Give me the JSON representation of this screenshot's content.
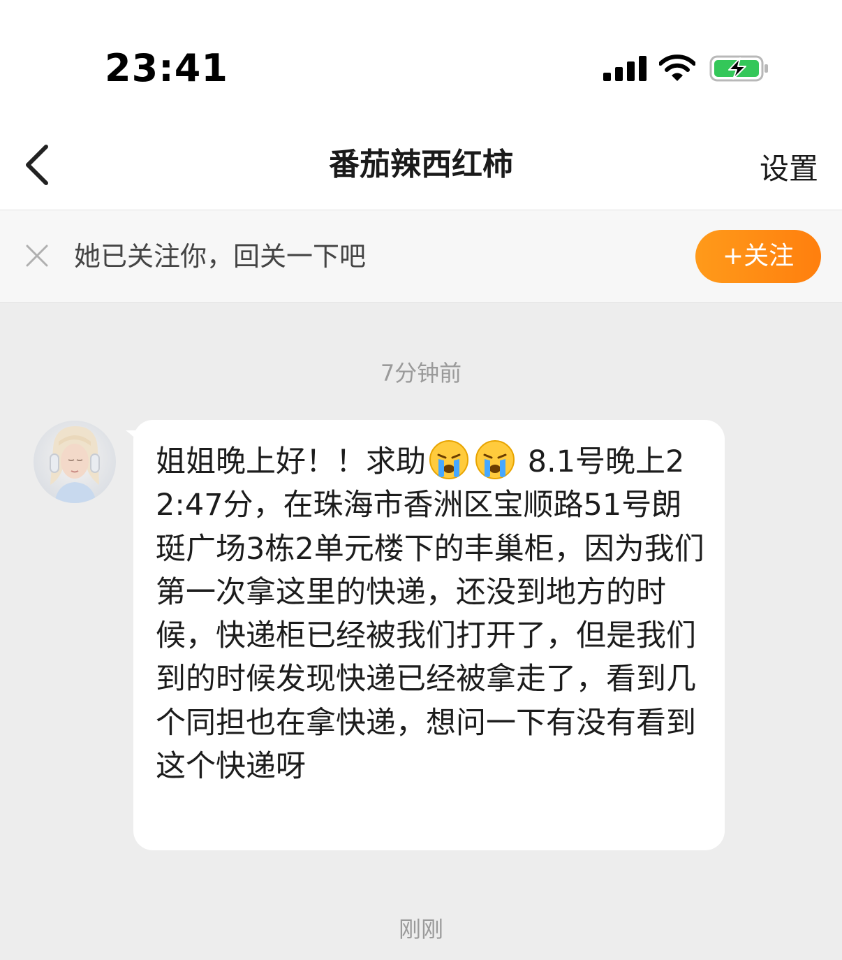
{
  "status_bar": {
    "time": "23:41",
    "icons": [
      "cellular-signal-icon",
      "wifi-icon",
      "battery-charging-icon"
    ],
    "battery_color": "#34c759"
  },
  "nav": {
    "back_icon": "chevron-left-icon",
    "title": "番茄辣西红柿",
    "settings_label": "设置"
  },
  "follow_prompt": {
    "close_icon": "close-icon",
    "text": "她已关注你，回关一下吧",
    "button_label": "+关注",
    "button_color": "#ff8c14"
  },
  "messages": [
    {
      "time_label": "7分钟前",
      "sender": "番茄辣西红柿",
      "text_before_emoji": "姐姐晚上好！！求助",
      "emojis": [
        "crying-face-emoji",
        "crying-face-emoji"
      ],
      "text_after_emoji": " 8.1号晚上22:47分，在珠海市香洲区宝顺路51号朗珽广场3栋2单元楼下的丰巢柜，因为我们第一次拿这里的快递，还没到地方的时候，快递柜已经被我们打开了，但是我们到的时候发现快递已经被拿走了，看到几个同担也在拿快递，想问一下有没有看到这个快递呀"
    }
  ],
  "footer_time_label": "刚刚"
}
